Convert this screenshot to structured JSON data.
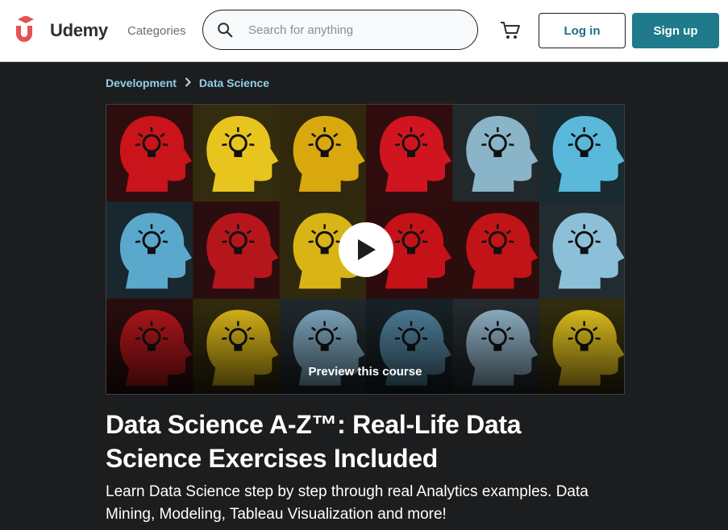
{
  "brand": {
    "name": "Udemy",
    "accent": "#a435f0",
    "logo_color": "#e35351"
  },
  "header": {
    "categories_label": "Categories",
    "search": {
      "placeholder": "Search for anything",
      "value": ""
    },
    "cart_icon": "cart-icon",
    "login_label": "Log in",
    "signup_label": "Sign up"
  },
  "breadcrumb": {
    "items": [
      "Development",
      "Data Science"
    ],
    "separator_icon": "chevron-right-icon"
  },
  "preview": {
    "label": "Preview this course",
    "play_icon": "play-icon"
  },
  "course": {
    "title": "Data Science A-Z™: Real-Life Data Science Exercises Included",
    "subtitle": "Learn Data Science step by step through real Analytics examples. Data Mining, Modeling, Tableau Visualization and more!"
  },
  "colors": {
    "page_bg": "#1c1d1f",
    "link": "#8fd1e6",
    "signup_bg": "#1f7a8c"
  }
}
